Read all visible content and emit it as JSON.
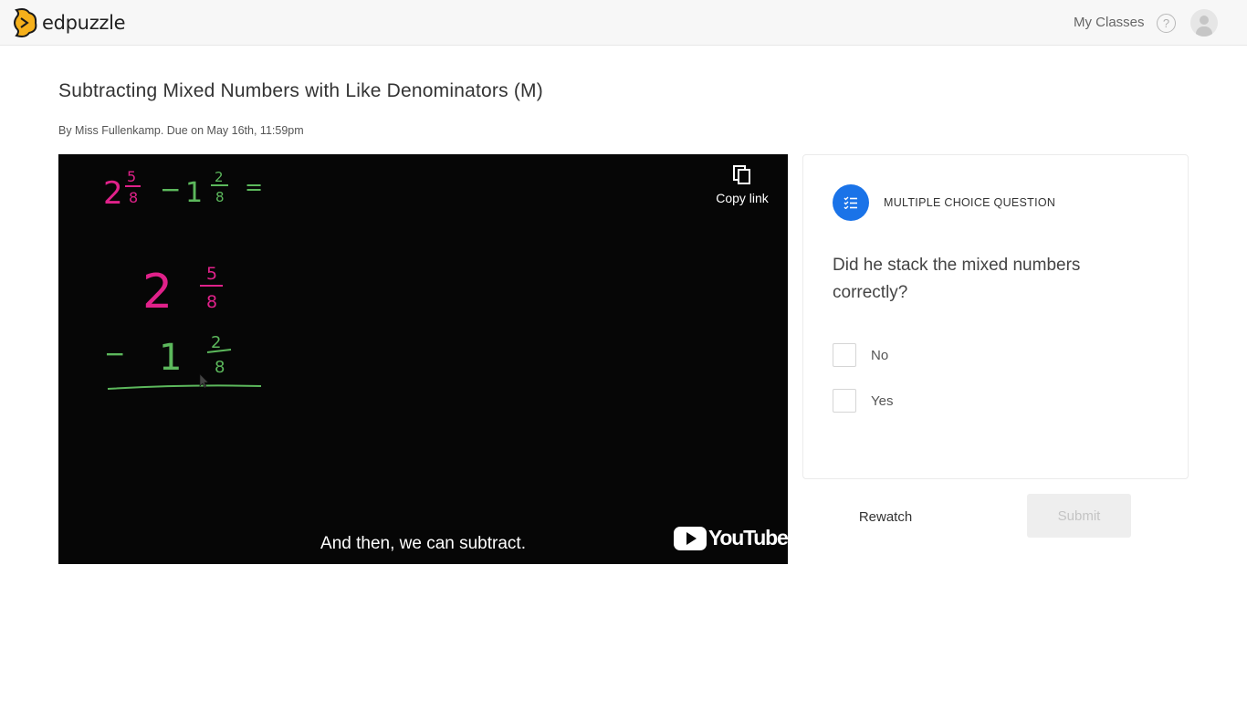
{
  "brand": {
    "name": "edpuzzle"
  },
  "nav": {
    "my_classes": "My Classes",
    "help_icon": "help-icon",
    "avatar_icon": "user-avatar-icon"
  },
  "assignment": {
    "title": "Subtracting Mixed Numbers with Like Denominators (M)",
    "byline": "By Miss Fullenkamp. Due on May 16th, 11:59pm"
  },
  "video": {
    "copy_link_label": "Copy link",
    "caption": "And then, we can subtract.",
    "platform": "YouTube",
    "board": {
      "equation": {
        "whole1": "2",
        "num1": "5",
        "den1": "8",
        "minus": "−",
        "whole2": "1",
        "num2": "2",
        "den2": "8",
        "equals": "="
      },
      "stack": {
        "whole1": "2",
        "num1": "5",
        "den1": "8",
        "minus": "−",
        "whole2": "1",
        "num2": "2",
        "den2": "8"
      },
      "colors": {
        "pink": "#e0218a",
        "green": "#5cb85c"
      }
    }
  },
  "question": {
    "type_label": "MULTIPLE CHOICE QUESTION",
    "text": "Did he stack the mixed numbers correctly?",
    "options": [
      {
        "label": "No"
      },
      {
        "label": "Yes"
      }
    ]
  },
  "actions": {
    "rewatch": "Rewatch",
    "submit": "Submit"
  },
  "colors": {
    "accent": "#1a73e8",
    "logo": "#f5b01b"
  }
}
